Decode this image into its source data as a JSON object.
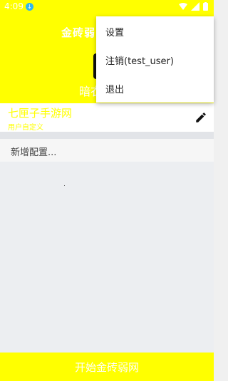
{
  "status_bar": {
    "time": "4:09"
  },
  "header": {
    "app_title": "金砖弱网",
    "mode_label": "暗衣"
  },
  "config": {
    "name": "七匣子手游网",
    "subtitle": "用户自定义"
  },
  "add_config": {
    "label": "新增配置..."
  },
  "start_button": {
    "label": "开始金砖弱网"
  },
  "menu": {
    "items": [
      {
        "label": "设置"
      },
      {
        "label": "注销(test_user)"
      },
      {
        "label": "退出"
      }
    ]
  },
  "colors": {
    "accent": "#ffff00",
    "background": "#eceef1",
    "card": "#ffffff"
  }
}
